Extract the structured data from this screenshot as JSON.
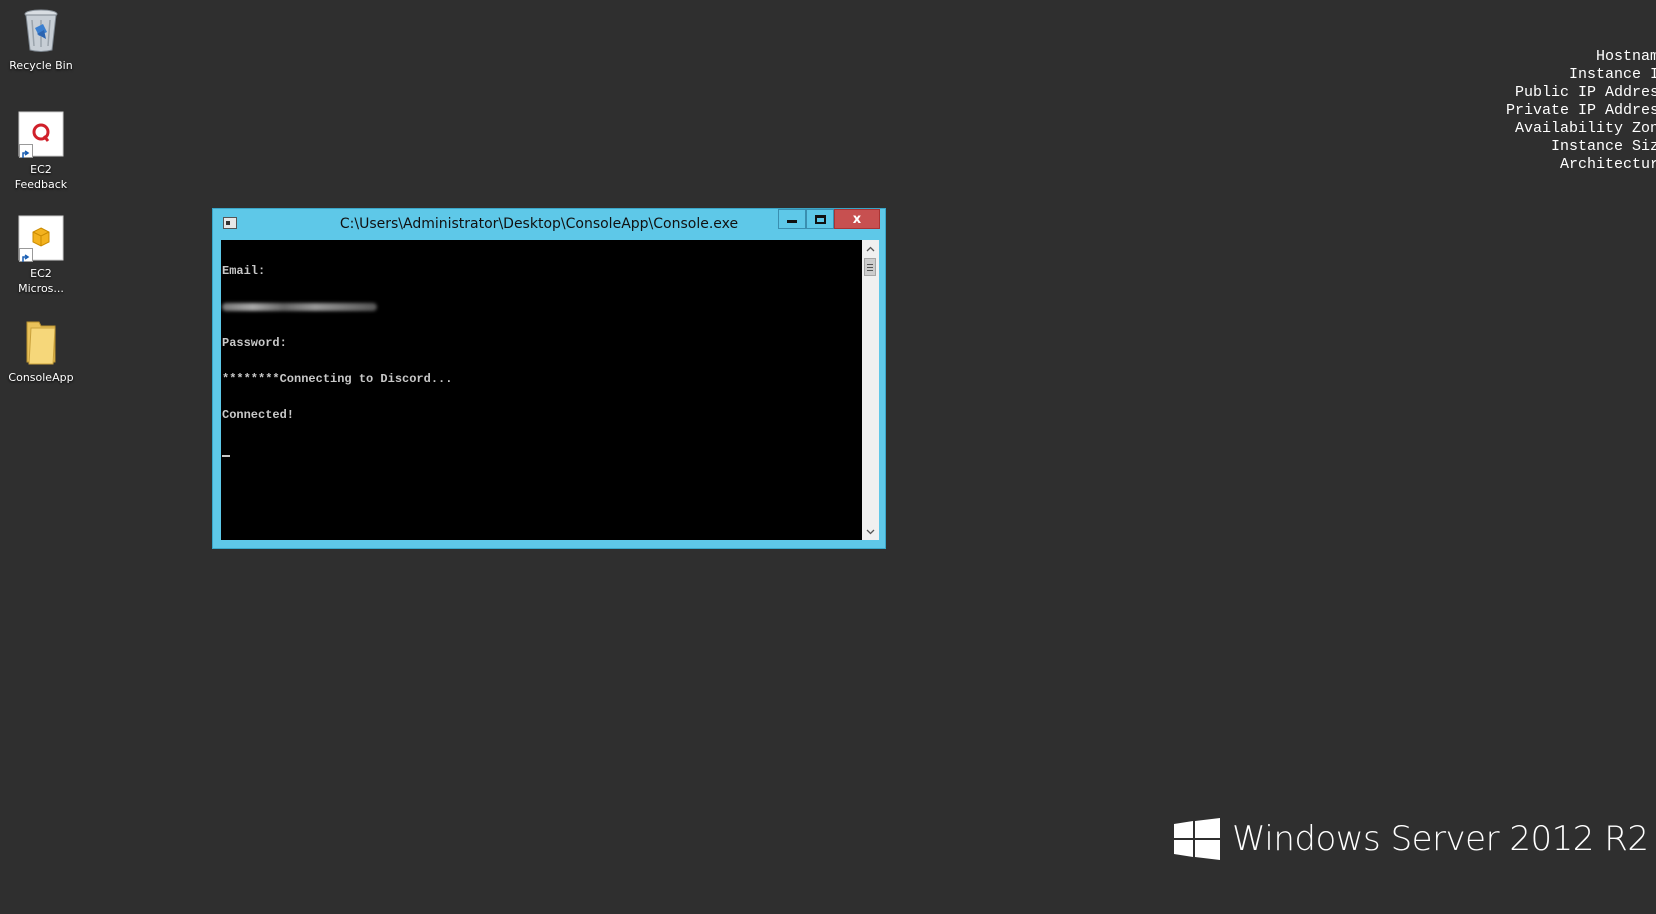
{
  "desktop": {
    "icons": [
      {
        "label": "Recycle Bin",
        "icon": "recycle-bin-icon"
      },
      {
        "label": "EC2\nFeedback",
        "icon": "ec2-feedback-icon"
      },
      {
        "label": "EC2\nMicros...",
        "icon": "ec2-microsoft-icon"
      },
      {
        "label": "ConsoleApp",
        "icon": "folder-icon"
      }
    ]
  },
  "info_panel": {
    "lines": [
      "Hostname",
      "Instance ID",
      "Public IP Address",
      "Private IP Address",
      "Availability Zone",
      "Instance Size",
      "Architecture"
    ]
  },
  "console_window": {
    "title": "C:\\Users\\Administrator\\Desktop\\ConsoleApp\\Console.exe",
    "close_label": "x",
    "lines": {
      "email_label": "Email:",
      "password_label": "Password:",
      "connecting": "********Connecting to Discord...",
      "connected": "Connected!"
    },
    "scroll_up": "^",
    "scroll_down": "v"
  },
  "branding": {
    "text": "Windows Server 2012 R2"
  },
  "colors": {
    "desktop_bg": "#2f2f2f",
    "window_frame": "#5ec8e8",
    "close_button": "#c75050",
    "console_bg": "#000000",
    "console_text": "#c8c8c8"
  }
}
